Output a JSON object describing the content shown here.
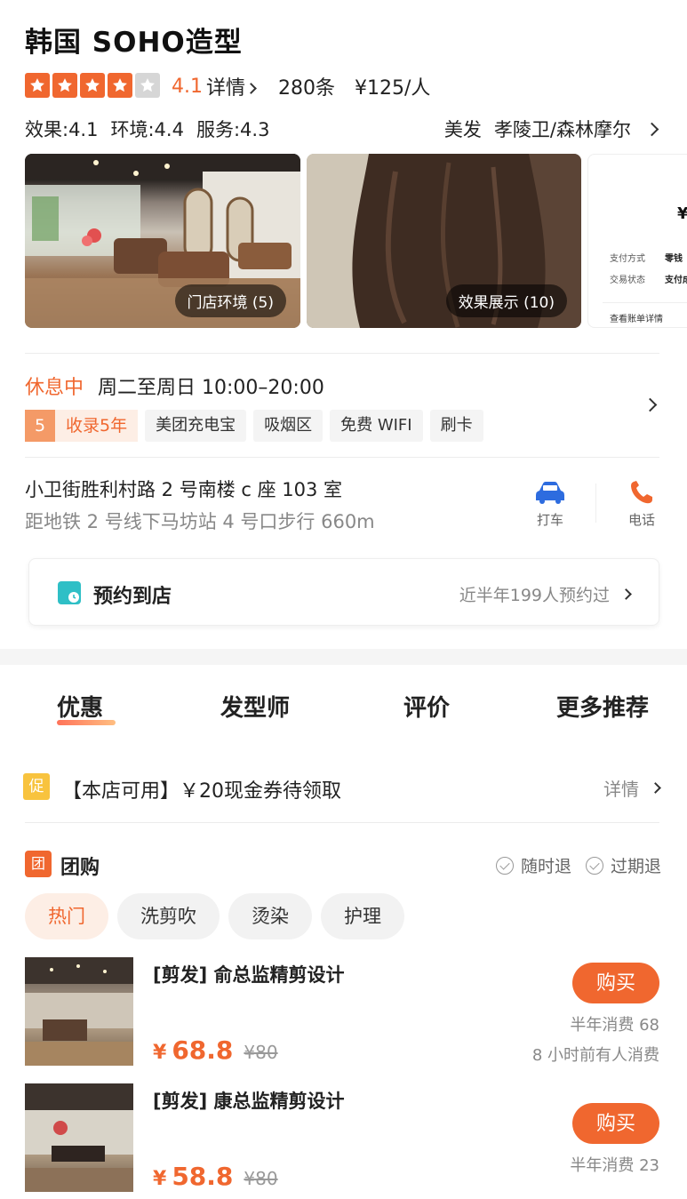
{
  "shop": {
    "name": "韩国 SOHO造型",
    "rating": "4.1",
    "rating_stars": 4,
    "detail_label": "详情",
    "review_count": "280条",
    "price_per_person": "¥125/人",
    "scores": {
      "effect": "效果:4.1",
      "environment": "环境:4.4",
      "service": "服务:4.3"
    },
    "category": "美发",
    "location": "孝陵卫/森林摩尔"
  },
  "photos": {
    "store_env": "门店环境 (5)",
    "effect_show": "效果展示 (10)",
    "receipt": {
      "amount": "¥",
      "pay_method_label": "支付方式",
      "pay_method_value": "零钱",
      "trade_status_label": "交易状态",
      "trade_status_value": "支付成",
      "bill_detail": "查看账单详情"
    }
  },
  "hours": {
    "status": "休息中",
    "schedule": "周二至周日 10:00–20:00"
  },
  "tags": {
    "years_num": "5",
    "years_text": "收录5年",
    "items": [
      "美团充电宝",
      "吸烟区",
      "免费 WIFI",
      "刷卡"
    ]
  },
  "address": {
    "line1": "小卫街胜利村路 2 号南楼 c 座 103 室",
    "line2": "距地铁 2 号线下马坊站 4 号口步行 660m",
    "taxi_label": "打车",
    "phone_label": "电话"
  },
  "reserve": {
    "label": "预约到店",
    "info": "近半年199人预约过"
  },
  "tabs": [
    "优惠",
    "发型师",
    "评价",
    "更多推荐"
  ],
  "promo": {
    "badge": "促",
    "text": "【本店可用】￥20现金券待领取",
    "detail": "详情"
  },
  "group_buy": {
    "badge": "团",
    "title": "团购",
    "guarantee1": "随时退",
    "guarantee2": "过期退",
    "filters": [
      "热门",
      "洗剪吹",
      "烫染",
      "护理"
    ]
  },
  "deals": [
    {
      "title": "[剪发] 俞总监精剪设计",
      "yen": "¥",
      "price": "68.8",
      "orig": "¥80",
      "buy": "购买",
      "sold": "半年消费 68",
      "recent": "8 小时前有人消费"
    },
    {
      "title": "[剪发] 康总监精剪设计",
      "yen": "¥",
      "price": "58.8",
      "orig": "¥80",
      "buy": "购买",
      "sold": "半年消费 23",
      "recent": ""
    }
  ],
  "colors": {
    "accent": "#f0672f",
    "promo_yellow": "#f8c33e",
    "reserve_teal": "#2fbfc6"
  }
}
